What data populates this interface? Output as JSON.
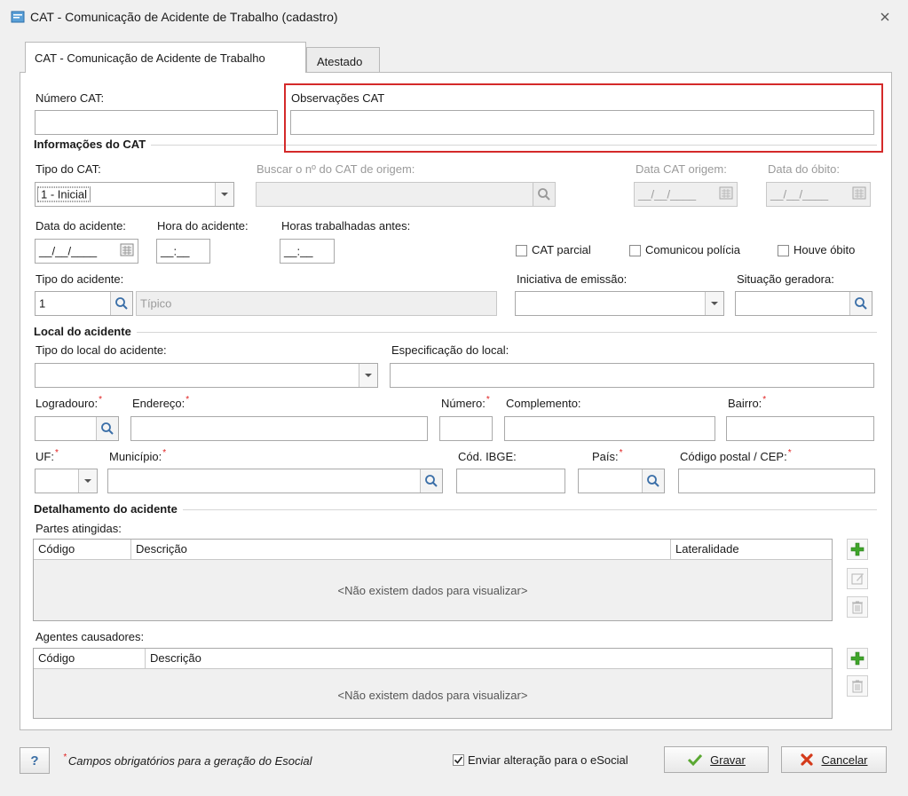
{
  "window": {
    "title": "CAT - Comunicação de Acidente de Trabalho (cadastro)"
  },
  "tabs": [
    {
      "label": "CAT - Comunicação de Acidente de Trabalho",
      "active": true
    },
    {
      "label": "Atestado",
      "active": false
    }
  ],
  "fields": {
    "numero_cat": {
      "label": "Número CAT:",
      "value": ""
    },
    "observacoes_cat": {
      "label": "Observações CAT",
      "value": ""
    }
  },
  "info_cat": {
    "section_title": "Informações do CAT",
    "tipo_cat": {
      "label": "Tipo do CAT:",
      "value": "1 - Inicial"
    },
    "buscar_origem": {
      "label": "Buscar o nº do CAT de origem:",
      "value": ""
    },
    "data_cat_origem": {
      "label": "Data CAT origem:",
      "value": "__/__/____"
    },
    "data_obito": {
      "label": "Data do óbito:",
      "value": "__/__/____"
    },
    "data_acidente": {
      "label": "Data do acidente:",
      "value": "__/__/____"
    },
    "hora_acidente": {
      "label": "Hora do acidente:",
      "value": "__:__"
    },
    "horas_trabalhadas": {
      "label": "Horas trabalhadas antes:",
      "value": "__:__"
    },
    "cat_parcial": {
      "label": "CAT parcial",
      "checked": false
    },
    "comunicou_policia": {
      "label": "Comunicou polícia",
      "checked": false
    },
    "houve_obito": {
      "label": "Houve óbito",
      "checked": false
    },
    "tipo_acidente": {
      "label": "Tipo do acidente:",
      "code": "1",
      "description": "Típico"
    },
    "iniciativa_emissao": {
      "label": "Iniciativa de emissão:",
      "value": ""
    },
    "situacao_geradora": {
      "label": "Situação geradora:",
      "value": ""
    }
  },
  "local": {
    "section_title": "Local do acidente",
    "tipo_local": {
      "label": "Tipo do local do acidente:",
      "value": ""
    },
    "especificacao": {
      "label": "Especificação do local:",
      "value": ""
    },
    "logradouro": {
      "label": "Logradouro:",
      "value": ""
    },
    "endereco": {
      "label": "Endereço:",
      "value": ""
    },
    "numero": {
      "label": "Número:",
      "value": ""
    },
    "complemento": {
      "label": "Complemento:",
      "value": ""
    },
    "bairro": {
      "label": "Bairro:",
      "value": ""
    },
    "uf": {
      "label": "UF:",
      "value": ""
    },
    "municipio": {
      "label": "Município:",
      "value": ""
    },
    "cod_ibge": {
      "label": "Cód. IBGE:",
      "value": ""
    },
    "pais": {
      "label": "País:",
      "value": ""
    },
    "cep": {
      "label": "Código postal / CEP:",
      "value": ""
    },
    "required_mark": "*"
  },
  "detalhamento": {
    "section_title": "Detalhamento do acidente",
    "partes": {
      "label": "Partes atingidas:",
      "columns": [
        "Código",
        "Descrição",
        "Lateralidade"
      ],
      "empty": "<Não existem dados para visualizar>"
    },
    "agentes": {
      "label": "Agentes causadores:",
      "columns": [
        "Código",
        "Descrição"
      ],
      "empty": "<Não existem dados para visualizar>"
    }
  },
  "footer": {
    "help_label": "?",
    "required_note": "Campos obrigatórios para a geração do Esocial",
    "enviar_esocial": {
      "label": "Enviar alteração para o eSocial",
      "checked": true
    },
    "gravar_label": "Gravar",
    "cancelar_label": "Cancelar"
  },
  "colors": {
    "highlight_box": "#d42a2a",
    "add_green": "#3fa52a",
    "cancel_red": "#d43a1a"
  }
}
